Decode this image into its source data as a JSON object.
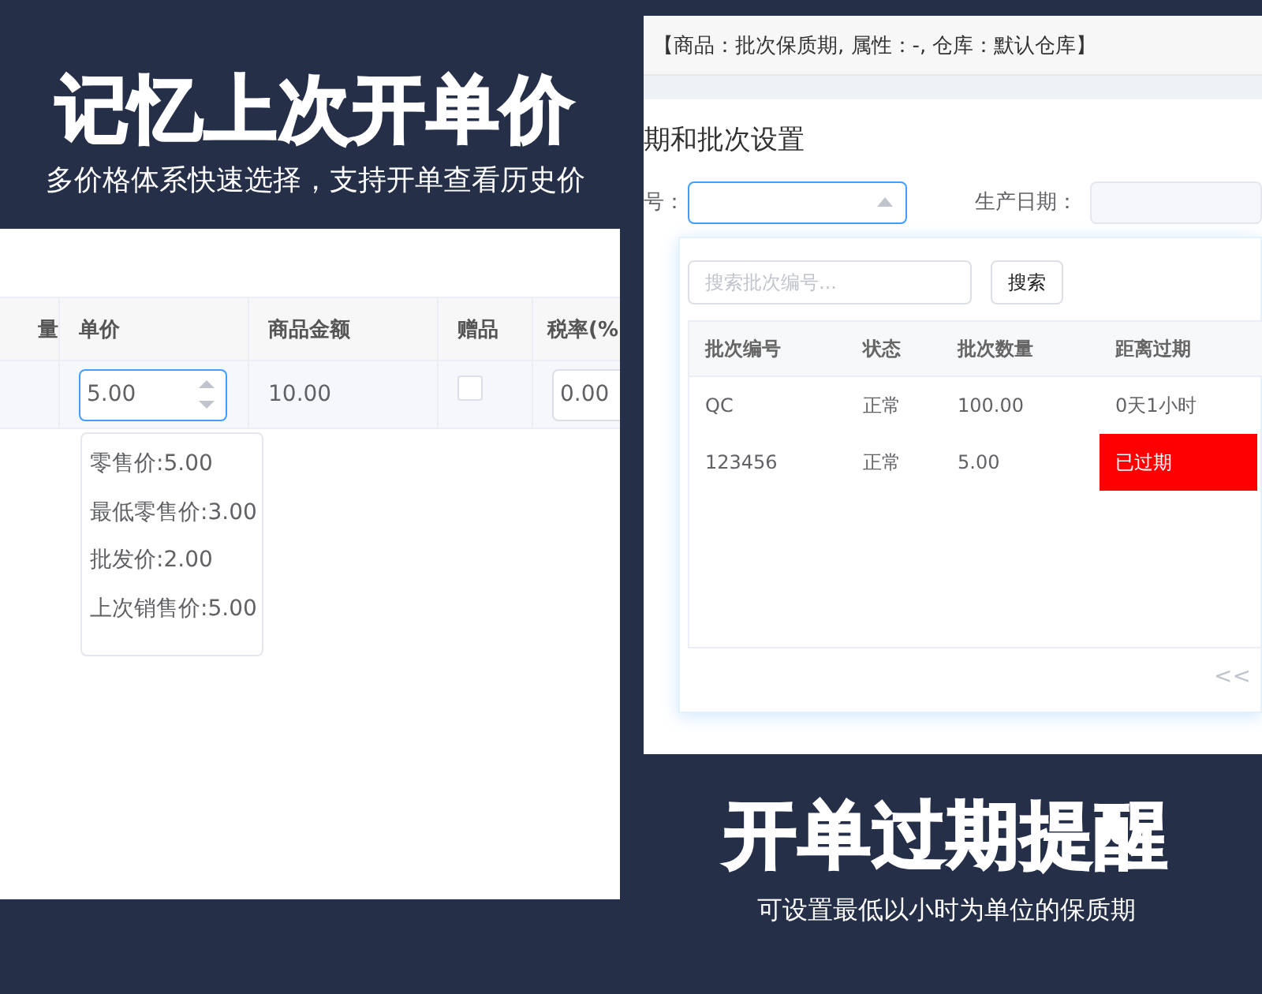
{
  "left_feature": {
    "title": "记忆上次开单价",
    "subtitle": "多价格体系快速选择，支持开单查看历史价"
  },
  "price_table": {
    "columns": [
      "量",
      "单价",
      "商品金额",
      "赠品",
      "税率(%"
    ],
    "row": {
      "unit_price": "5.00",
      "amount": "10.00",
      "gift": false,
      "tax_rate": "0.00"
    },
    "price_options": [
      "零售价:5.00",
      "最低零售价:3.00",
      "批发价:2.00",
      "上次销售价:5.00"
    ]
  },
  "batch_dialog": {
    "header": "【商品：批次保质期, 属性：-, 仓库：默认仓库】",
    "title": "期和批次设置",
    "batch_label": "号：",
    "production_date_label": "生产日期：",
    "search": {
      "placeholder": "搜索批次编号...",
      "button": "搜索"
    },
    "columns": [
      "批次编号",
      "状态",
      "批次数量",
      "距离过期"
    ],
    "rows": [
      {
        "batch": "QC",
        "status": "正常",
        "quantity": "100.00",
        "expiry": "0天1小时",
        "expired": false
      },
      {
        "batch": "123456",
        "status": "正常",
        "quantity": "5.00",
        "expiry": "已过期",
        "expired": true
      }
    ],
    "pager": "<<"
  },
  "right_feature": {
    "title": "开单过期提醒",
    "subtitle": "可设置最低以小时为单位的保质期"
  }
}
